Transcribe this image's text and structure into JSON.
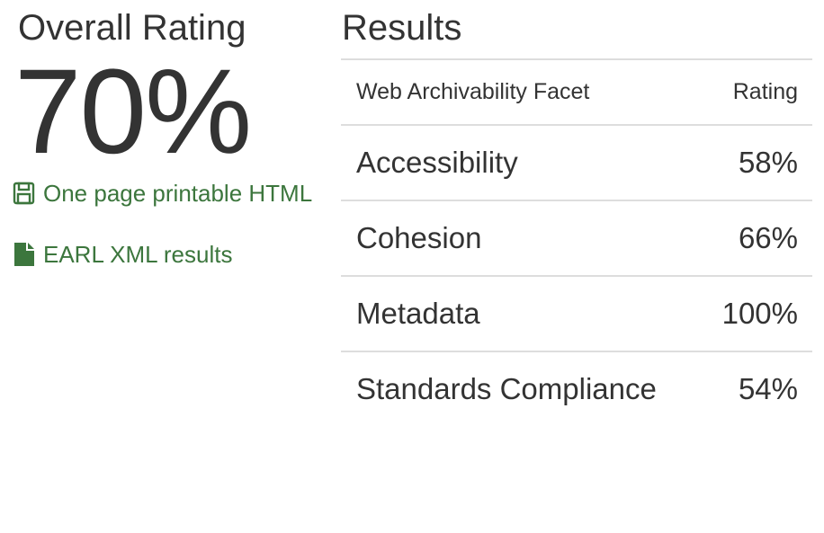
{
  "overall": {
    "title": "Overall Rating",
    "value": "70%"
  },
  "links": {
    "html": {
      "icon": "floppy-disk-icon",
      "label": "One page printable HTML"
    },
    "earl": {
      "icon": "file-icon",
      "label": "EARL XML results"
    }
  },
  "results": {
    "title": "Results",
    "columns": [
      "Web Archivability Facet",
      "Rating"
    ],
    "rows": [
      {
        "facet": "Accessibility",
        "rating": "58%"
      },
      {
        "facet": "Cohesion",
        "rating": "66%"
      },
      {
        "facet": "Metadata",
        "rating": "100%"
      },
      {
        "facet": "Standards Compliance",
        "rating": "54%"
      }
    ]
  },
  "colors": {
    "link": "#3c763d",
    "text": "#333333",
    "rule": "#dddddd"
  }
}
